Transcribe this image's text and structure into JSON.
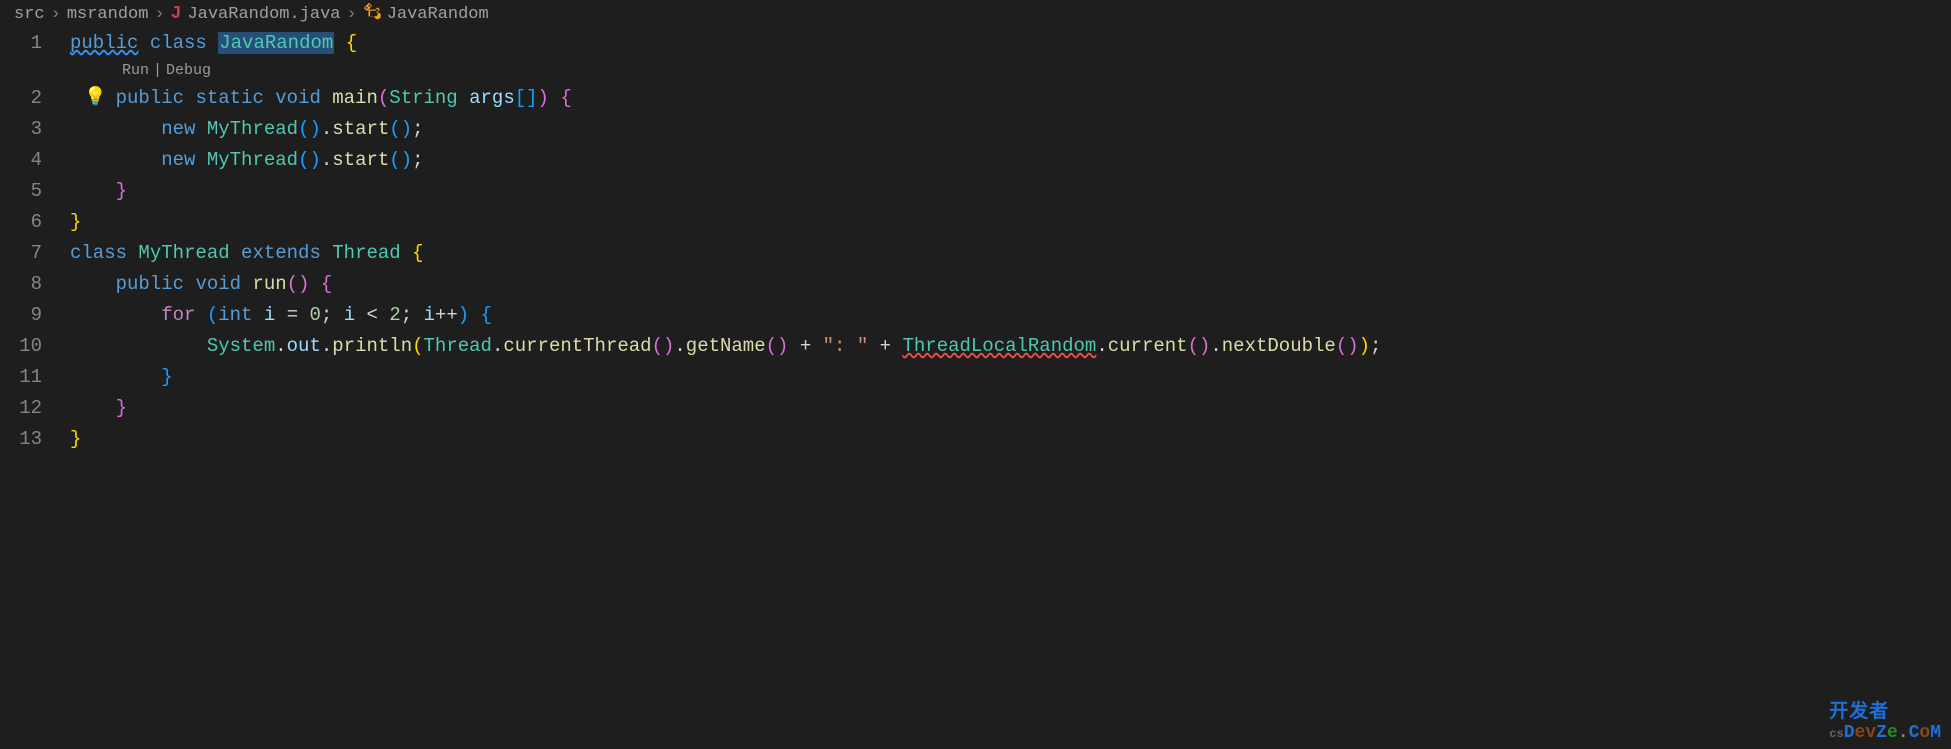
{
  "breadcrumb": {
    "items": [
      {
        "label": "src"
      },
      {
        "label": "msrandom"
      },
      {
        "label": "JavaRandom.java",
        "icon": "java"
      },
      {
        "label": "JavaRandom",
        "icon": "class"
      }
    ]
  },
  "codelens": {
    "run": "Run",
    "debug": "Debug"
  },
  "lines": [
    {
      "num": "1"
    },
    {
      "num": "2"
    },
    {
      "num": "3"
    },
    {
      "num": "4"
    },
    {
      "num": "5"
    },
    {
      "num": "6"
    },
    {
      "num": "7"
    },
    {
      "num": "8"
    },
    {
      "num": "9"
    },
    {
      "num": "10"
    },
    {
      "num": "11"
    },
    {
      "num": "12"
    },
    {
      "num": "13"
    }
  ],
  "code": {
    "l1": {
      "public": "public",
      "class": "class",
      "className": "JavaRandom",
      "brace": "{"
    },
    "l2": {
      "public": "public",
      "static": "static",
      "void": "void",
      "main": "main",
      "lp": "(",
      "String": "String",
      "args": "args",
      "br": "[]",
      "rp": ")",
      "brace": "{"
    },
    "l3": {
      "new": "new",
      "MyThread": "MyThread",
      "lp": "(",
      "rp": ")",
      "dot": ".",
      "start": "start",
      "lp2": "(",
      "rp2": ")",
      "semi": ";"
    },
    "l4": {
      "new": "new",
      "MyThread": "MyThread",
      "lp": "(",
      "rp": ")",
      "dot": ".",
      "start": "start",
      "lp2": "(",
      "rp2": ")",
      "semi": ";"
    },
    "l5": {
      "brace": "}"
    },
    "l6": {
      "brace": "}"
    },
    "l7": {
      "class": "class",
      "MyThread": "MyThread",
      "extends": "extends",
      "Thread": "Thread",
      "brace": "{"
    },
    "l8": {
      "public": "public",
      "void": "void",
      "run": "run",
      "lp": "(",
      "rp": ")",
      "brace": "{"
    },
    "l9": {
      "for": "for",
      "lp": "(",
      "int": "int",
      "i1": "i",
      "eq": "=",
      "zero": "0",
      "semi1": ";",
      "i2": "i",
      "lt": "<",
      "two": "2",
      "semi2": ";",
      "i3": "i",
      "pp": "++",
      "rp": ")",
      "brace": "{"
    },
    "l10": {
      "System": "System",
      "d1": ".",
      "out": "out",
      "d2": ".",
      "println": "println",
      "lp": "(",
      "Thread": "Thread",
      "d3": ".",
      "currentThread": "currentThread",
      "lp2": "(",
      "rp2": ")",
      "d4": ".",
      "getName": "getName",
      "lp3": "(",
      "rp3": ")",
      "plus1": "+",
      "str": "\": \"",
      "plus2": "+",
      "TLR": "ThreadLocalRandom",
      "d5": ".",
      "current": "current",
      "lp4": "(",
      "rp4": ")",
      "d6": ".",
      "nextDouble": "nextDouble",
      "lp5": "(",
      "rp5": ")",
      "rp": ")",
      "semi": ";"
    },
    "l11": {
      "brace": "}"
    },
    "l12": {
      "brace": "}"
    },
    "l13": {
      "brace": "}"
    }
  },
  "watermark": {
    "top": "开发者",
    "csPrefix": "cs",
    "d": "D",
    "ev": "ev",
    "z": "Z",
    "e": "e",
    "dot": ".",
    "c": "C",
    "o": "o",
    "m": "M"
  }
}
